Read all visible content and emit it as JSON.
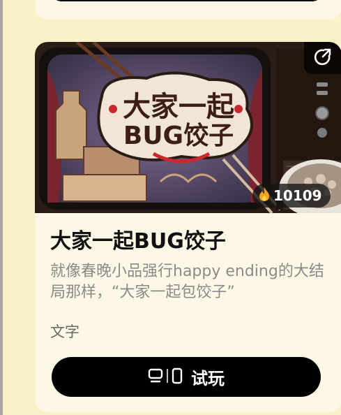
{
  "card": {
    "title": "大家一起BUG饺子",
    "description": "就像春晚小品强行happy ending的大结局那样，“大家一起包饺子”",
    "tag": "文字",
    "plays": "10109",
    "play_button_label": "试玩",
    "thumbnail_text": "大家一起BUG饺子"
  },
  "colors": {
    "page_bg": "#FBF1C8",
    "card_bg": "#FDF8E6",
    "button_bg": "#000000",
    "title": "#111111",
    "description": "#8A8A8A"
  },
  "icons": {
    "share": "share-external-icon",
    "fire": "fire-icon",
    "desktop": "desktop-icon",
    "mobile": "mobile-icon"
  }
}
